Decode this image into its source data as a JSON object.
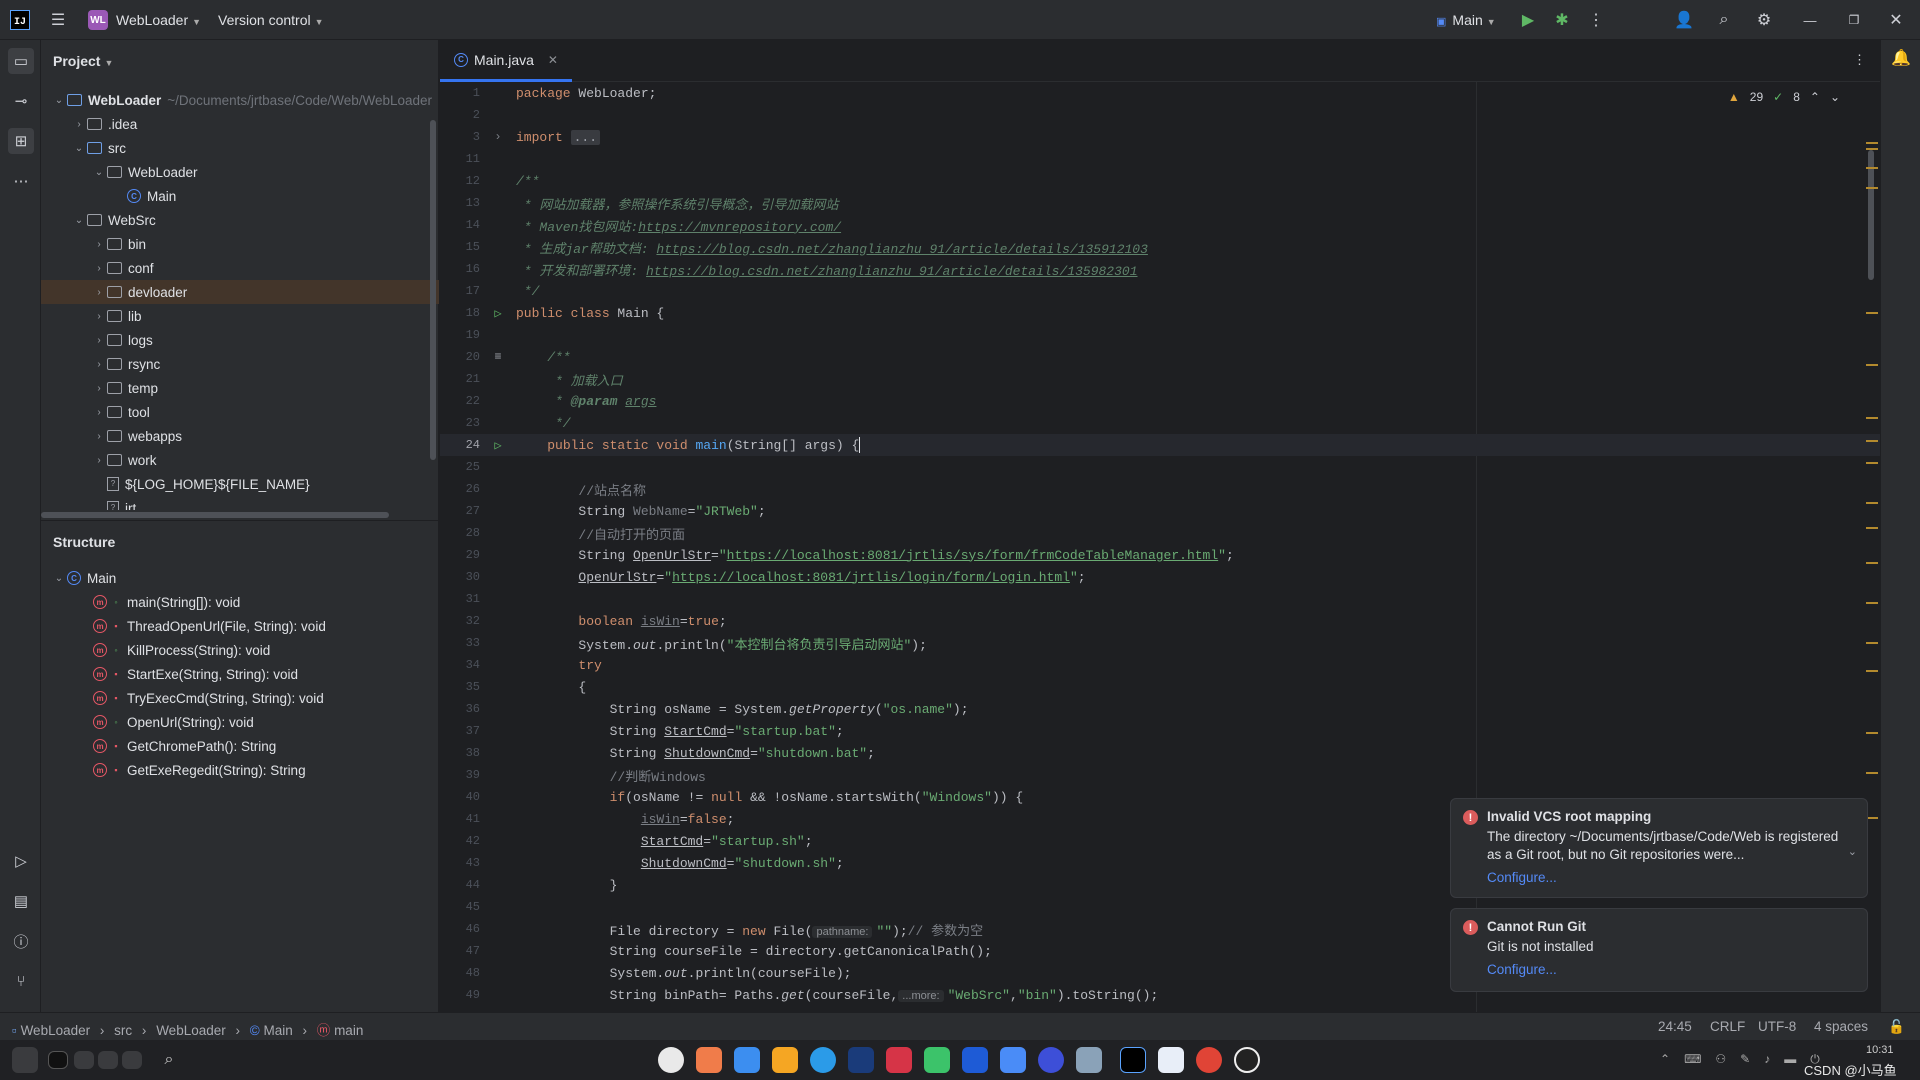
{
  "titlebar": {
    "project_badge": "WL",
    "project_name": "WebLoader",
    "version_control": "Version control",
    "run_config": "Main"
  },
  "project_panel": {
    "title": "Project",
    "tree": [
      {
        "label": "WebLoader",
        "path": "~/Documents/jrtbase/Code/Web/WebLoader",
        "type": "module",
        "expanded": true,
        "depth": 0
      },
      {
        "label": ".idea",
        "type": "folder",
        "expanded": false,
        "depth": 1
      },
      {
        "label": "src",
        "type": "folder-src",
        "expanded": true,
        "depth": 1
      },
      {
        "label": "WebLoader",
        "type": "package",
        "expanded": true,
        "depth": 2
      },
      {
        "label": "Main",
        "type": "class",
        "depth": 3
      },
      {
        "label": "WebSrc",
        "type": "folder",
        "expanded": true,
        "depth": 1
      },
      {
        "label": "bin",
        "type": "folder",
        "expanded": false,
        "depth": 2
      },
      {
        "label": "conf",
        "type": "folder",
        "expanded": false,
        "depth": 2
      },
      {
        "label": "devloader",
        "type": "folder",
        "expanded": false,
        "depth": 2,
        "selected": true
      },
      {
        "label": "lib",
        "type": "folder",
        "expanded": false,
        "depth": 2
      },
      {
        "label": "logs",
        "type": "folder",
        "expanded": false,
        "depth": 2
      },
      {
        "label": "rsync",
        "type": "folder",
        "expanded": false,
        "depth": 2
      },
      {
        "label": "temp",
        "type": "folder",
        "expanded": false,
        "depth": 2
      },
      {
        "label": "tool",
        "type": "folder",
        "expanded": false,
        "depth": 2
      },
      {
        "label": "webapps",
        "type": "folder",
        "expanded": false,
        "depth": 2
      },
      {
        "label": "work",
        "type": "folder",
        "expanded": false,
        "depth": 2
      },
      {
        "label": "${LOG_HOME}${FILE_NAME}",
        "type": "file",
        "depth": 2
      },
      {
        "label": "jrt",
        "type": "file",
        "depth": 2
      }
    ]
  },
  "structure_panel": {
    "title": "Structure",
    "root": "Main",
    "members": [
      {
        "label": "main(String[]): void",
        "vis": "public"
      },
      {
        "label": "ThreadOpenUrl(File, String): void",
        "vis": "private"
      },
      {
        "label": "KillProcess(String): void",
        "vis": "public"
      },
      {
        "label": "StartExe(String, String): void",
        "vis": "private"
      },
      {
        "label": "TryExecCmd(String, String): void",
        "vis": "private"
      },
      {
        "label": "OpenUrl(String): void",
        "vis": "public"
      },
      {
        "label": "GetChromePath(): String",
        "vis": "private"
      },
      {
        "label": "GetExeRegedit(String): String",
        "vis": "private"
      }
    ]
  },
  "editor": {
    "tab_label": "Main.java",
    "warnings": "29",
    "weak_warnings": "8",
    "line_numbers": [
      "1",
      "2",
      "3",
      "11",
      "12",
      "13",
      "14",
      "15",
      "16",
      "17",
      "18",
      "19",
      "20",
      "21",
      "22",
      "23",
      "24",
      "25",
      "26",
      "27",
      "28",
      "29",
      "30",
      "31",
      "32",
      "33",
      "34",
      "35",
      "36",
      "37",
      "38",
      "39",
      "40",
      "41",
      "42",
      "43",
      "44",
      "45",
      "46",
      "47",
      "48",
      "49"
    ]
  },
  "notifications": [
    {
      "title": "Invalid VCS root mapping",
      "body": "The directory ~/Documents/jrtbase/Code/Web is registered as a Git root, but no Git repositories were...",
      "link": "Configure..."
    },
    {
      "title": "Cannot Run Git",
      "body": "Git is not installed",
      "link": "Configure..."
    }
  ],
  "statusbar": {
    "breadcrumbs": [
      "WebLoader",
      "src",
      "WebLoader",
      "Main",
      "main"
    ],
    "position": "24:45",
    "line_sep": "CRLF",
    "encoding": "UTF-8",
    "indent": "4 spaces"
  },
  "taskbar": {
    "time": "10:31",
    "watermark": "CSDN @小马鱼"
  },
  "colors": {
    "accent": "#3574f0",
    "error": "#db5c5c",
    "keyword": "#cf8e6d",
    "string": "#6aab73"
  }
}
